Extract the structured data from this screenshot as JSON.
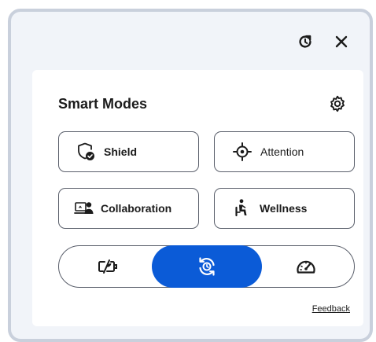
{
  "toolbar": {
    "history_icon": "history-icon",
    "close_icon": "close-icon"
  },
  "smart_modes": {
    "title": "Smart Modes",
    "settings_icon": "gear-icon",
    "modes": [
      {
        "label": "Shield",
        "icon": "shield-check-icon",
        "selected": false
      },
      {
        "label": "Attention",
        "icon": "crosshair-icon",
        "selected": false
      },
      {
        "label": "Collaboration",
        "icon": "collaboration-icon",
        "selected": false
      },
      {
        "label": "Wellness",
        "icon": "seated-person-icon",
        "selected": false
      }
    ]
  },
  "performance_switch": {
    "options": [
      {
        "icon": "battery-saver-icon",
        "selected": false
      },
      {
        "icon": "adaptive-sync-icon",
        "selected": true
      },
      {
        "icon": "speedometer-icon",
        "selected": false
      }
    ]
  },
  "footer": {
    "feedback_link": "Feedback"
  },
  "colors": {
    "accent": "#0b5bd7",
    "window_bg": "#f1f4f9",
    "border": "#5a5f6b"
  }
}
